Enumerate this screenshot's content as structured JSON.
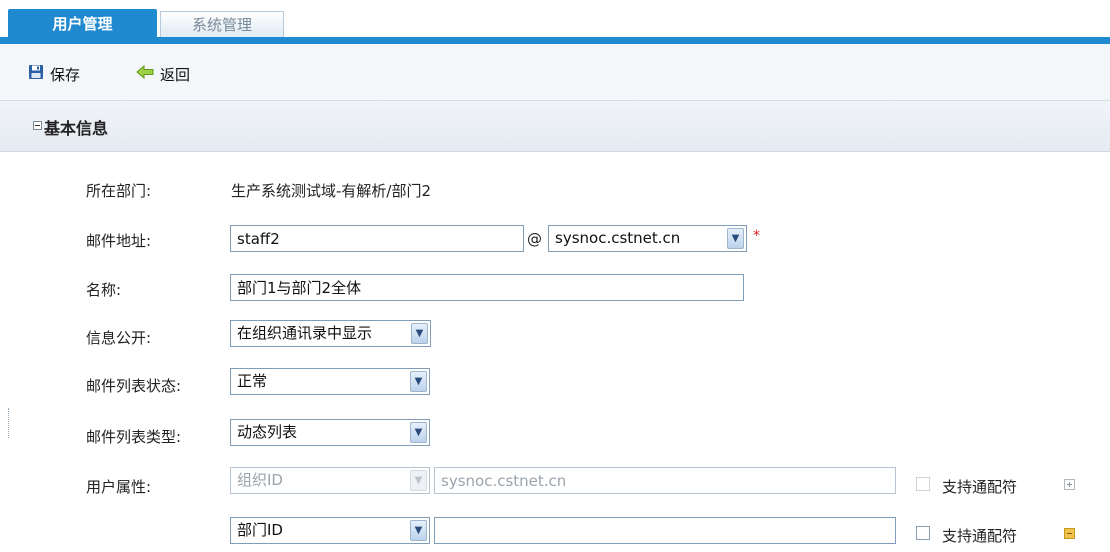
{
  "tabs": [
    {
      "label": "用户管理",
      "active": true
    },
    {
      "label": "系统管理",
      "active": false
    }
  ],
  "toolbar": {
    "save_label": "保存",
    "save_icon": "floppy-disk-icon",
    "back_label": "返回",
    "back_icon": "back-arrow-icon"
  },
  "section": {
    "title": "基本信息"
  },
  "form": {
    "department": {
      "label": "所在部门:",
      "value": "生产系统测试域-有解析/部门2"
    },
    "email": {
      "label": "邮件地址:",
      "value": "staff2",
      "at": "@",
      "domain": "sysnoc.cstnet.cn",
      "required_mark": "*"
    },
    "name": {
      "label": "名称:",
      "value": "部门1与部门2全体"
    },
    "visibility": {
      "label": "信息公开:",
      "value": "在组织通讯录中显示"
    },
    "list_status": {
      "label": "邮件列表状态:",
      "value": "正常"
    },
    "list_type": {
      "label": "邮件列表类型:",
      "value": "动态列表"
    },
    "user_attr": {
      "label": "用户属性:",
      "rows": [
        {
          "attr": "组织ID",
          "value": "sysnoc.cstnet.cn",
          "wildcard_label": "支持通配符",
          "disabled": true
        },
        {
          "attr": "部门ID",
          "value": "",
          "wildcard_label": "支持通配符",
          "disabled": false
        }
      ]
    }
  },
  "colors": {
    "accent": "#1f8ad0",
    "required": "#e02020"
  }
}
